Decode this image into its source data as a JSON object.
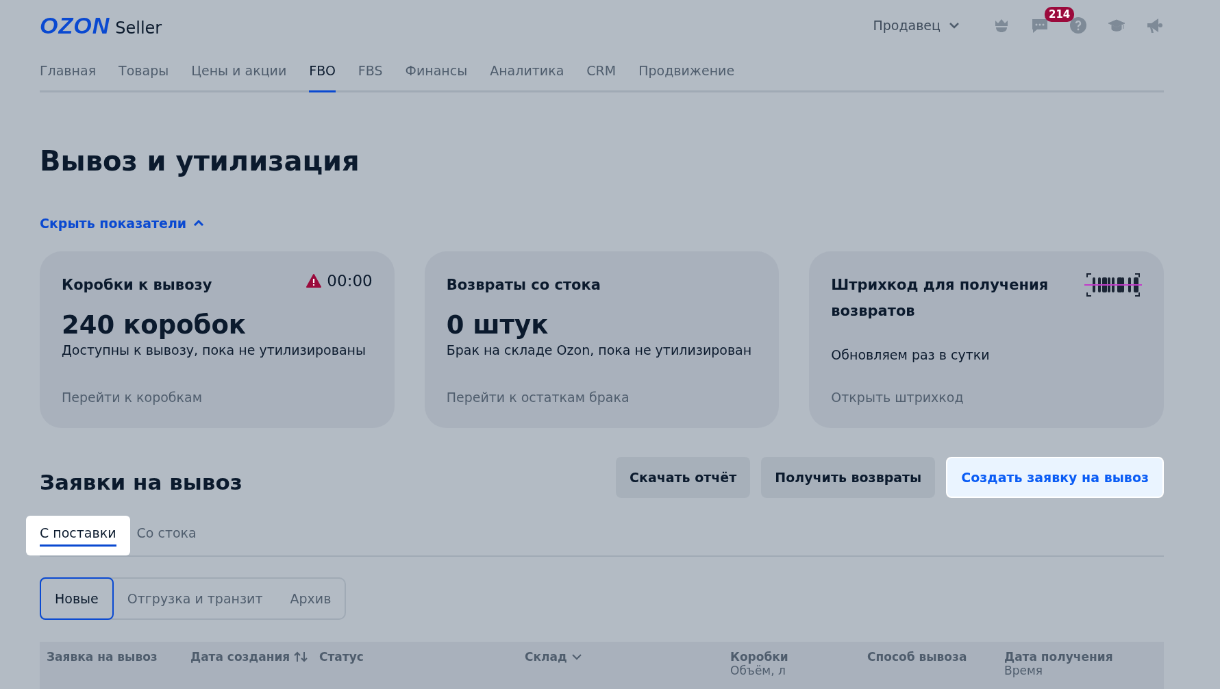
{
  "header": {
    "logo": "OZON",
    "logo_suffix": "Seller",
    "account": "Продавец",
    "notifications_badge": "214"
  },
  "nav": [
    {
      "label": "Главная",
      "selected": false
    },
    {
      "label": "Товары",
      "selected": false
    },
    {
      "label": "Цены и акции",
      "selected": false
    },
    {
      "label": "FBO",
      "selected": true
    },
    {
      "label": "FBS",
      "selected": false
    },
    {
      "label": "Финансы",
      "selected": false
    },
    {
      "label": "Аналитика",
      "selected": false
    },
    {
      "label": "CRM",
      "selected": false
    },
    {
      "label": "Продвижение",
      "selected": false
    }
  ],
  "page_title": "Вывоз и утилизация",
  "toggle_metrics": {
    "label": "Скрыть показатели",
    "expanded": true
  },
  "cards": [
    {
      "kind": "timer",
      "title": "Коробки к вывозу",
      "timer": "00:00",
      "value": "240 коробок",
      "description": "Доступны к вывозу, пока не утилизированы",
      "link": "Перейти к коробкам"
    },
    {
      "kind": "plain",
      "title": "Возвраты со стока",
      "value": "0 штук",
      "description": "Брак на складе Ozon, пока не утилизирован",
      "link": "Перейти к остаткам брака"
    },
    {
      "kind": "barcode",
      "title": "Штрихкод для получения возвратов",
      "description": "Обновляем раз в сутки",
      "link": "Открыть штрихкод"
    }
  ],
  "section": {
    "title": "Заявки на вывоз",
    "buttons": [
      {
        "label": "Скачать отчёт",
        "highlighted": false
      },
      {
        "label": "Получить возвраты",
        "highlighted": false
      },
      {
        "label": "Создать заявку на вывоз",
        "highlighted": true
      }
    ],
    "tabs": [
      {
        "label": "С поставки",
        "selected": true,
        "highlighted": true
      },
      {
        "label": "Со стока",
        "selected": false,
        "highlighted": false
      }
    ],
    "filters": [
      {
        "label": "Новые",
        "selected": true
      },
      {
        "label": "Отгрузка и транзит",
        "selected": false
      },
      {
        "label": "Архив",
        "selected": false
      }
    ],
    "columns": [
      {
        "label": "Заявка на вывоз"
      },
      {
        "label": "Дата создания",
        "kind": "sort"
      },
      {
        "label": "Статус"
      },
      {
        "label": "Склад",
        "kind": "dropdown"
      },
      {
        "label": "Коробки",
        "sublabel": "Объём, л"
      },
      {
        "label": "Способ вывоза"
      },
      {
        "label": "Дата получения",
        "sublabel": "Время"
      }
    ]
  }
}
